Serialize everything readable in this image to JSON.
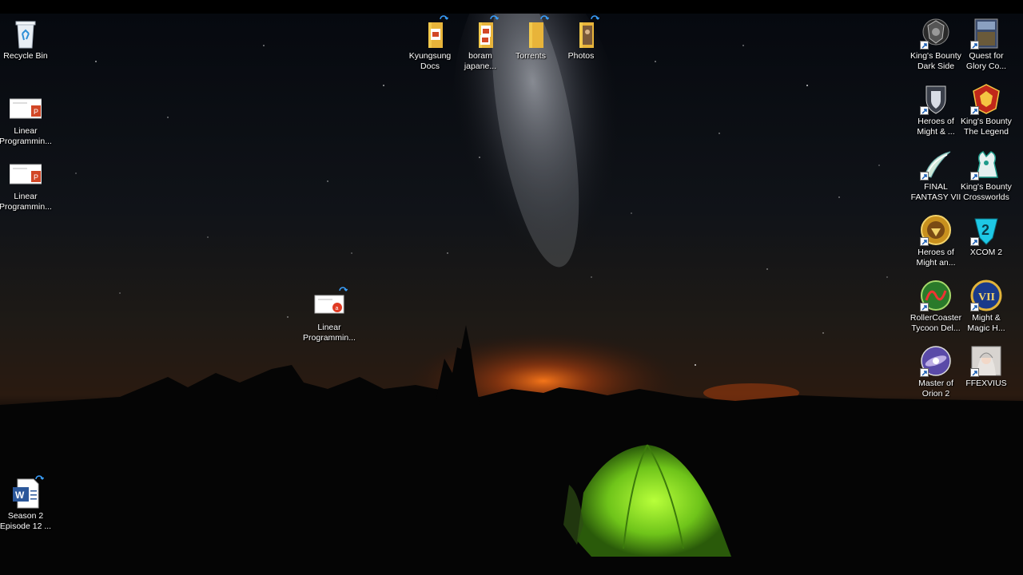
{
  "desktop": {
    "icons": [
      {
        "id": "recycle",
        "label": "Recycle Bin",
        "icon": "recycle-bin-icon"
      },
      {
        "id": "lp1",
        "label": "Linear\nProgrammin...",
        "icon": "powerpoint-file-icon"
      },
      {
        "id": "lp2",
        "label": "Linear\nProgrammin...",
        "icon": "powerpoint-file-icon"
      },
      {
        "id": "season2",
        "label": "Season 2\nEpisode 12 ...",
        "icon": "word-document-icon"
      },
      {
        "id": "lp3",
        "label": "Linear\nProgrammin...",
        "icon": "pdf-file-icon"
      },
      {
        "id": "kyungsung",
        "label": "Kyungsung\nDocs",
        "icon": "folder-icon"
      },
      {
        "id": "boram",
        "label": "boram\njapane...",
        "icon": "folder-icon"
      },
      {
        "id": "torrents",
        "label": "Torrents",
        "icon": "folder-icon"
      },
      {
        "id": "photos",
        "label": "Photos",
        "icon": "folder-icon"
      },
      {
        "id": "kbdark",
        "label": "King's Bounty\nDark Side",
        "icon": "kings-bounty-dark-side-icon"
      },
      {
        "id": "qfg",
        "label": "Quest for\nGlory Co...",
        "icon": "quest-for-glory-icon"
      },
      {
        "id": "homm1",
        "label": "Heroes of\nMight & ...",
        "icon": "heroes-of-might-shield-icon"
      },
      {
        "id": "kblegend",
        "label": "King's Bounty\nThe Legend",
        "icon": "kings-bounty-legend-icon"
      },
      {
        "id": "ff7",
        "label": "FINAL\nFANTASY VII",
        "icon": "final-fantasy-vii-icon"
      },
      {
        "id": "kbcross",
        "label": "King's Bounty\nCrossworlds",
        "icon": "kings-bounty-crossworlds-icon"
      },
      {
        "id": "homm2",
        "label": "Heroes of\nMight an...",
        "icon": "heroes-of-might-gold-icon"
      },
      {
        "id": "xcom2",
        "label": "XCOM 2",
        "icon": "xcom-2-icon"
      },
      {
        "id": "rct",
        "label": "RollerCoaster\nTycoon Del...",
        "icon": "rollercoaster-tycoon-icon"
      },
      {
        "id": "mm7",
        "label": "Might &\nMagic H...",
        "icon": "might-and-magic-icon"
      },
      {
        "id": "moo2",
        "label": "Master of\nOrion 2",
        "icon": "master-of-orion-icon"
      },
      {
        "id": "ffexvius",
        "label": "FFEXVIUS",
        "icon": "ffexvius-icon"
      }
    ]
  },
  "colors": {
    "folder": "#f2c94c",
    "powerpoint": "#d24726",
    "word": "#2b579a",
    "sky_top": "#050810",
    "horizon_glow": "#e8621a",
    "tent": "#7ed321"
  }
}
